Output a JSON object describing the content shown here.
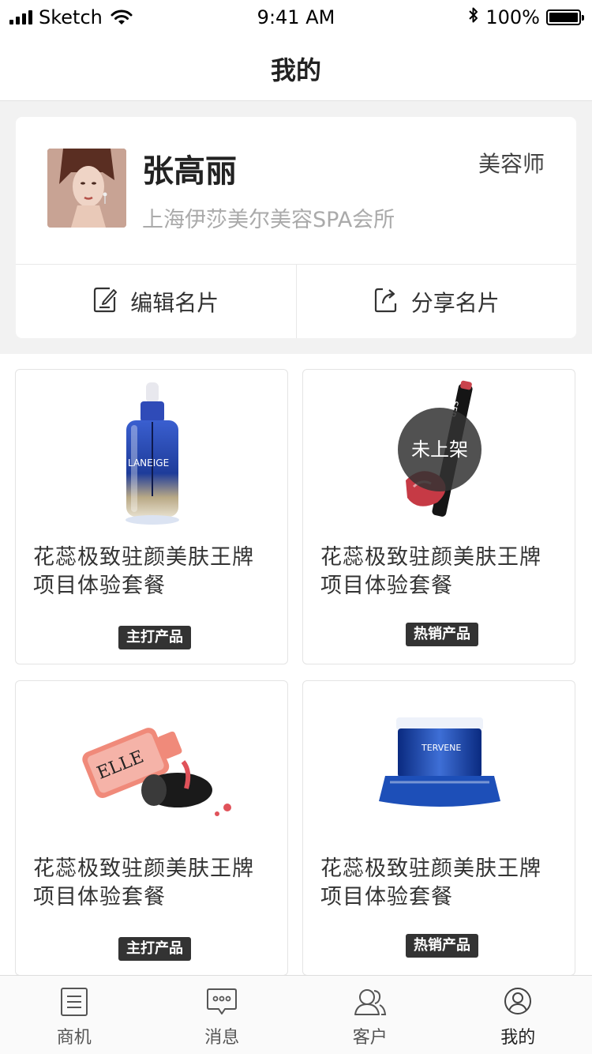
{
  "status_bar": {
    "carrier": "Sketch",
    "time": "9:41 AM",
    "battery": "100%",
    "battery_level": 1.0
  },
  "nav": {
    "title": "我的"
  },
  "profile": {
    "name": "张高丽",
    "org": "上海伊莎美尔美容SPA会所",
    "role": "美容师",
    "actions": [
      {
        "label": "编辑名片",
        "icon": "edit-icon"
      },
      {
        "label": "分享名片",
        "icon": "share-icon"
      }
    ]
  },
  "products": [
    {
      "title_line1": "花蕊极致驻颜美肤王牌",
      "title_line2": "项目体验套餐",
      "tag": "主打产品",
      "image": "laneige-serum-bottle"
    },
    {
      "title_line1": "花蕊极致驻颜美肤王牌",
      "title_line2": "项目体验套餐",
      "tag": "热销产品",
      "image": "lip-gloss",
      "badge": "未上架"
    },
    {
      "title_line1": "花蕊极致驻颜美肤王牌",
      "title_line2": "项目体验套餐",
      "tag": "主打产品",
      "image": "elle-nail-polish"
    },
    {
      "title_line1": "花蕊极致驻颜美肤王牌",
      "title_line2": "项目体验套餐",
      "tag": "热销产品",
      "image": "intervene-night-cream"
    }
  ],
  "tabs": [
    {
      "label": "商机",
      "icon": "document-icon"
    },
    {
      "label": "消息",
      "icon": "message-icon"
    },
    {
      "label": "客户",
      "icon": "customers-icon"
    },
    {
      "label": "我的",
      "icon": "user-icon",
      "active": true
    }
  ]
}
